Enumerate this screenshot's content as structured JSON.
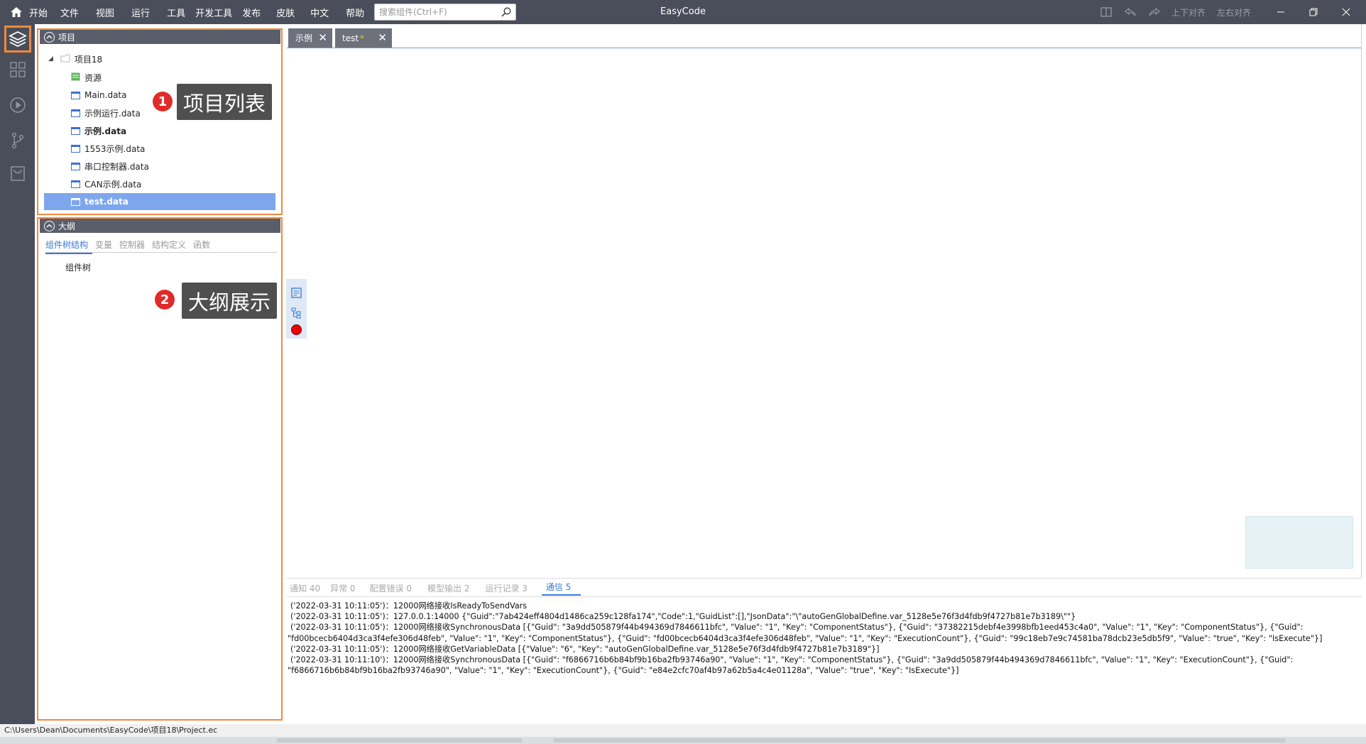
{
  "app": {
    "title": "EasyCode"
  },
  "menu": [
    "开始",
    "文件",
    "视图",
    "运行",
    "工具",
    "开发工具",
    "发布",
    "皮肤",
    "中文",
    "帮助"
  ],
  "search": {
    "placeholder": "搜索组件(Ctrl+F)"
  },
  "toolbar_right": {
    "align_vertical": "上下对齐",
    "align_horizontal": "左右对齐"
  },
  "project_panel": {
    "title": "项目",
    "root": "项目18",
    "items": [
      "资源",
      "Main.data",
      "示例运行.data",
      "示例.data",
      "1553示例.data",
      "串口控制器.data",
      "CAN示例.data",
      "test.data"
    ],
    "selected": "test.data",
    "bold": "示例.data"
  },
  "outline_panel": {
    "title": "大纲",
    "tabs": [
      "组件树结构",
      "变量",
      "控制器",
      "结构定义",
      "函数"
    ],
    "active_tab": "组件树结构",
    "tree_root": "组件树"
  },
  "callouts": [
    {
      "num": "1",
      "text": "项目列表"
    },
    {
      "num": "2",
      "text": "大纲展示"
    }
  ],
  "doc_tabs": [
    {
      "label": "示例",
      "modified": ""
    },
    {
      "label": "test",
      "modified": "*"
    }
  ],
  "output": {
    "tabs": [
      "通知 40",
      "异常 0",
      "配置错误 0",
      "模型输出 2",
      "运行记录 3",
      "通信 5"
    ],
    "active_tab": "通信 5",
    "lines": [
      "('2022-03-31 10:11:05')：12000网络接收IsReadyToSendVars",
      "('2022-03-31 10:11:05')：127.0.0.1:14000  {\"Guid\":\"7ab424eff4804d1486ca259c128fa174\",\"Code\":1,\"GuidList\":[],\"JsonData\":\"\\\"autoGenGlobalDefine.var_5128e5e76f3d4fdb9f4727b81e7b3189\\\"\"}",
      "('2022-03-31 10:11:05')：12000网络接收SynchronousData  [{\"Guid\": \"3a9dd505879f44b494369d7846611bfc\", \"Value\": \"1\", \"Key\": \"ComponentStatus\"}, {\"Guid\": \"37382215debf4e3998bfb1eed453c4a0\", \"Value\": \"1\", \"Key\": \"ComponentStatus\"}, {\"Guid\":",
      "\"fd00bcecb6404d3ca3f4efe306d48feb\", \"Value\": \"1\", \"Key\": \"ComponentStatus\"}, {\"Guid\": \"fd00bcecb6404d3ca3f4efe306d48feb\", \"Value\": \"1\", \"Key\": \"ExecutionCount\"}, {\"Guid\": \"99c18eb7e9c74581ba78dcb23e5db5f9\", \"Value\": \"true\", \"Key\": \"IsExecute\"}]",
      "('2022-03-31 10:11:05')：12000网络接收GetVariableData  [{\"Value\": \"6\", \"Key\": \"autoGenGlobalDefine.var_5128e5e76f3d4fdb9f4727b81e7b3189\"}]",
      "('2022-03-31 10:11:10')：12000网络接收SynchronousData  [{\"Guid\": \"f6866716b6b84bf9b16ba2fb93746a90\", \"Value\": \"1\", \"Key\": \"ComponentStatus\"}, {\"Guid\": \"3a9dd505879f44b494369d7846611bfc\", \"Value\": \"1\", \"Key\": \"ExecutionCount\"}, {\"Guid\":",
      "\"f6866716b6b84bf9b16ba2fb93746a90\", \"Value\": \"1\", \"Key\": \"ExecutionCount\"}, {\"Guid\": \"e84e2cfc70af4b97a62b5a4c4e01128a\", \"Value\": \"true\", \"Key\": \"IsExecute\"}]"
    ]
  },
  "status": {
    "path": "C:\\Users\\Dean\\Documents\\EasyCode\\项目18\\Project.ec"
  },
  "colors": {
    "titlebar": "#4a4e5a",
    "highlight": "#f08a3c",
    "selection": "#7ea6ec",
    "accent": "#3a78d8"
  }
}
